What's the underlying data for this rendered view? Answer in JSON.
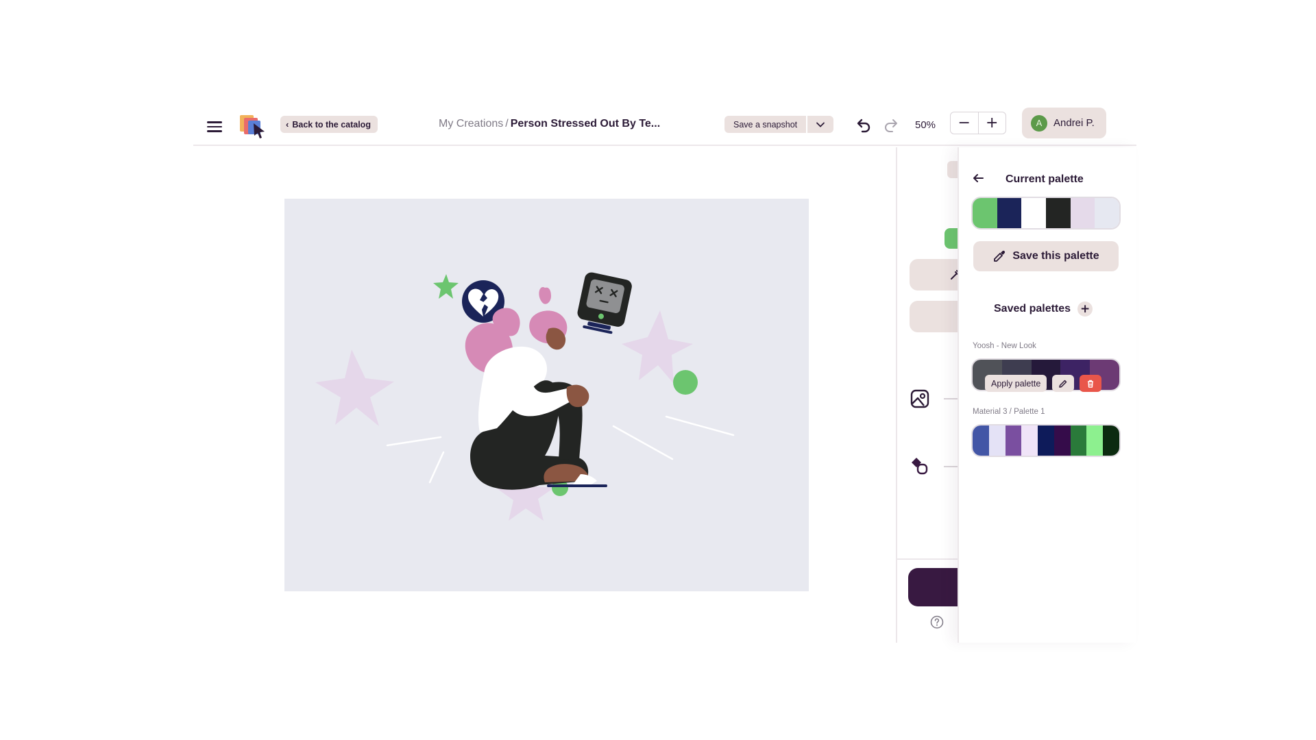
{
  "header": {
    "back_label": "Back to the catalog",
    "breadcrumb_parent": "My Creations",
    "breadcrumb_separator": "/",
    "title": "Person Stressed Out By Te...",
    "snapshot_label": "Save a snapshot",
    "zoom": "50%",
    "zoom_out": "−",
    "zoom_in": "+",
    "user_initial": "A",
    "user_name": "Andrei P."
  },
  "palette_panel": {
    "title": "Current palette",
    "current_colors": [
      "#6cc56f",
      "#1b2459",
      "#ffffff",
      "#232523",
      "#e5daea",
      "#e6e8f1"
    ],
    "save_label": "Save this palette",
    "saved_heading": "Saved palettes",
    "add_symbol": "+",
    "saved": [
      {
        "name": "Yoosh - New Look",
        "colors": [
          "#505258",
          "#3e3d50",
          "#25193a",
          "#3d2364",
          "#6c3a74"
        ],
        "apply_label": "Apply palette"
      },
      {
        "name": "Material 3 / Palette 1",
        "colors": [
          "#4356a6",
          "#e4e2f6",
          "#7a4fa0",
          "#f0e4f8",
          "#0e1b5a",
          "#350c4a",
          "#2a7a3a",
          "#8df08f",
          "#0c2b10"
        ]
      }
    ]
  },
  "icons": {
    "menu": "menu-icon",
    "logo": "app-logo",
    "undo": "undo-icon",
    "redo": "redo-icon",
    "image": "image-icon",
    "shapes": "shapes-icon",
    "help": "help-icon",
    "eyedropper": "eyedropper-icon",
    "pencil": "pencil-icon",
    "trash": "trash-icon",
    "arrow_left": "arrow-left-icon"
  },
  "colors": {
    "accent_dark": "#381941",
    "chip_bg": "#ebe1df",
    "canvas_bg": "#e8e9f0",
    "danger": "#e9564a"
  }
}
